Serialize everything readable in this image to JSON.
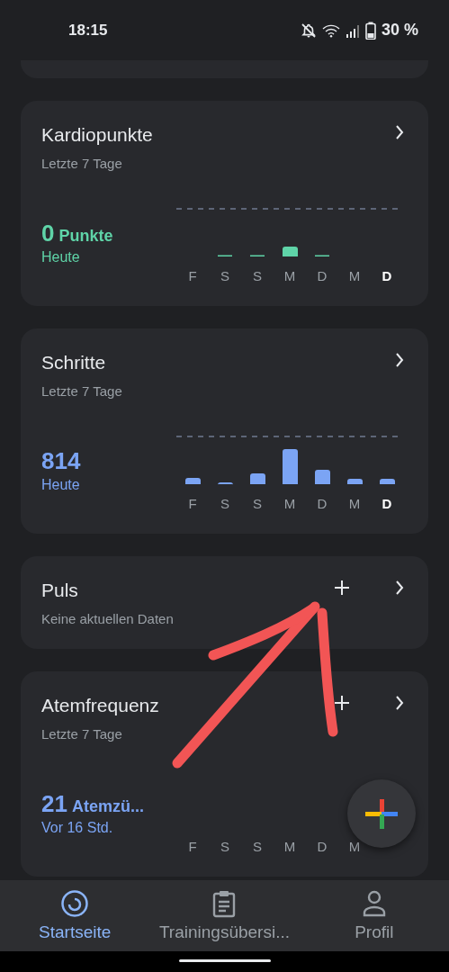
{
  "status_bar": {
    "time": "18:15",
    "battery": "30 %"
  },
  "cards": [
    {
      "kind": "chart",
      "title": "Kardiopunkte",
      "subtitle": "Letzte 7 Tage",
      "value": "0",
      "unit": "Punkte",
      "caption": "Heute",
      "color": "#5fd4a8",
      "add_button": false,
      "days": [
        {
          "label": "F",
          "current": false
        },
        {
          "label": "S",
          "current": false
        },
        {
          "label": "S",
          "current": false
        },
        {
          "label": "M",
          "current": false
        },
        {
          "label": "D",
          "current": false
        },
        {
          "label": "M",
          "current": false
        },
        {
          "label": "D",
          "current": true
        }
      ]
    },
    {
      "kind": "chart",
      "title": "Schritte",
      "subtitle": "Letzte 7 Tage",
      "value": "814",
      "caption": "Heute",
      "color": "#7ba4f4",
      "add_button": false,
      "days": [
        {
          "label": "F",
          "current": false
        },
        {
          "label": "S",
          "current": false
        },
        {
          "label": "S",
          "current": false
        },
        {
          "label": "M",
          "current": false
        },
        {
          "label": "D",
          "current": false
        },
        {
          "label": "M",
          "current": false
        },
        {
          "label": "D",
          "current": true
        }
      ]
    },
    {
      "kind": "simple",
      "title": "Puls",
      "subtitle": "Keine aktuellen Daten",
      "add_button": true
    },
    {
      "kind": "chart",
      "title": "Atemfrequenz",
      "subtitle": "Letzte 7 Tage",
      "value": "21",
      "unit": "Atemzü...",
      "caption": "Vor 16 Std.",
      "color": "#7ba4f4",
      "add_button": true,
      "days": [
        {
          "label": "F",
          "current": false
        },
        {
          "label": "S",
          "current": false
        },
        {
          "label": "S",
          "current": false
        },
        {
          "label": "M",
          "current": false
        },
        {
          "label": "D",
          "current": false
        },
        {
          "label": "M",
          "current": false
        }
      ]
    }
  ],
  "annotation": {
    "kind": "arrow"
  },
  "bottom_nav": [
    {
      "label": "Startseite",
      "selected": true
    },
    {
      "label": "Trainingsübersi...",
      "selected": false
    },
    {
      "label": "Profil",
      "selected": false
    }
  ]
}
